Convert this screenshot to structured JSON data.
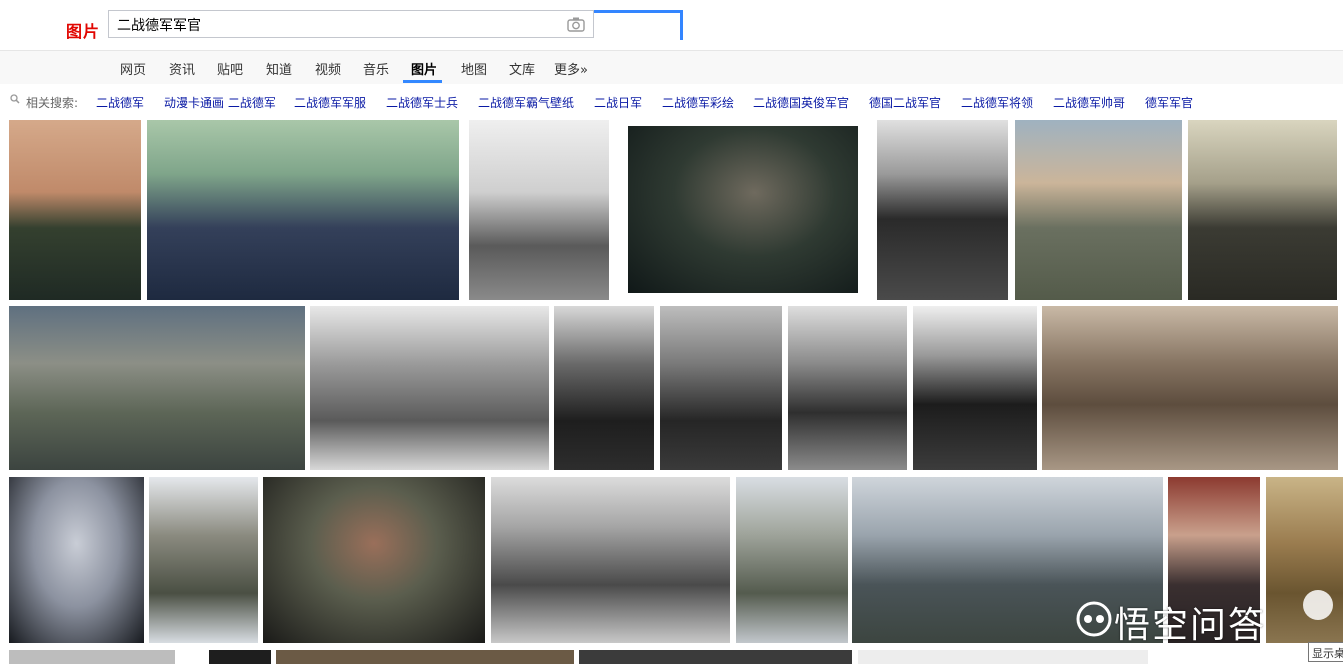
{
  "header": {
    "logo_text": "图片",
    "search_value": "二战德军军官",
    "camera_icon": "camera-icon"
  },
  "nav": {
    "items": [
      {
        "label": "网页"
      },
      {
        "label": "资讯"
      },
      {
        "label": "贴吧"
      },
      {
        "label": "知道"
      },
      {
        "label": "视频"
      },
      {
        "label": "音乐"
      },
      {
        "label": "图片",
        "active": true
      },
      {
        "label": "地图"
      },
      {
        "label": "文库"
      },
      {
        "label": "更多»"
      }
    ]
  },
  "related": {
    "label": "相关搜索:",
    "items": [
      "二战德军",
      "动漫卡通画 二战德军",
      "二战德军军服",
      "二战德军士兵",
      "二战德军霸气壁纸",
      "二战日军",
      "二战德军彩绘",
      "二战德国英俊军官",
      "德国二战军官",
      "二战德军将领",
      "二战德军帅哥",
      "德军军官"
    ]
  },
  "watermark": {
    "text": "悟空问答"
  },
  "tooltip": {
    "text": "显示桌"
  },
  "colors": {
    "logo": "#e10601",
    "link": "#0a1aa5",
    "accent": "#3385ff"
  }
}
